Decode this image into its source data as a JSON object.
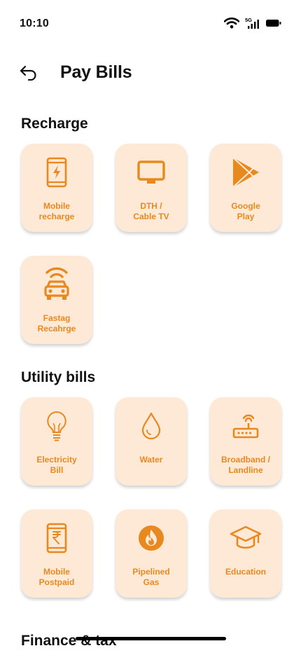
{
  "status_bar": {
    "time": "10:10",
    "network": "5G"
  },
  "header": {
    "title": "Pay Bills"
  },
  "sections": {
    "recharge": {
      "heading": "Recharge",
      "tiles": [
        {
          "label": "Mobile\nrecharge",
          "icon": "mobile-recharge-icon"
        },
        {
          "label": "DTH /\nCable TV",
          "icon": "tv-icon"
        },
        {
          "label": "Google\nPlay",
          "icon": "google-play-icon"
        },
        {
          "label": "Fastag\nRecahrge",
          "icon": "fastag-car-icon"
        }
      ]
    },
    "utility": {
      "heading": "Utility bills",
      "tiles": [
        {
          "label": "Electricity\nBill",
          "icon": "bulb-icon"
        },
        {
          "label": "Water",
          "icon": "water-drop-icon"
        },
        {
          "label": "Broadband /\nLandline",
          "icon": "router-icon"
        },
        {
          "label": "Mobile\nPostpaid",
          "icon": "mobile-rupee-icon"
        },
        {
          "label": "Pipelined\nGas",
          "icon": "gas-flame-icon"
        },
        {
          "label": "Education",
          "icon": "graduation-cap-icon"
        }
      ]
    },
    "finance": {
      "heading": "Finance & tax"
    }
  },
  "colors": {
    "tile_bg": "#fde9d6",
    "accent": "#e8891f"
  }
}
